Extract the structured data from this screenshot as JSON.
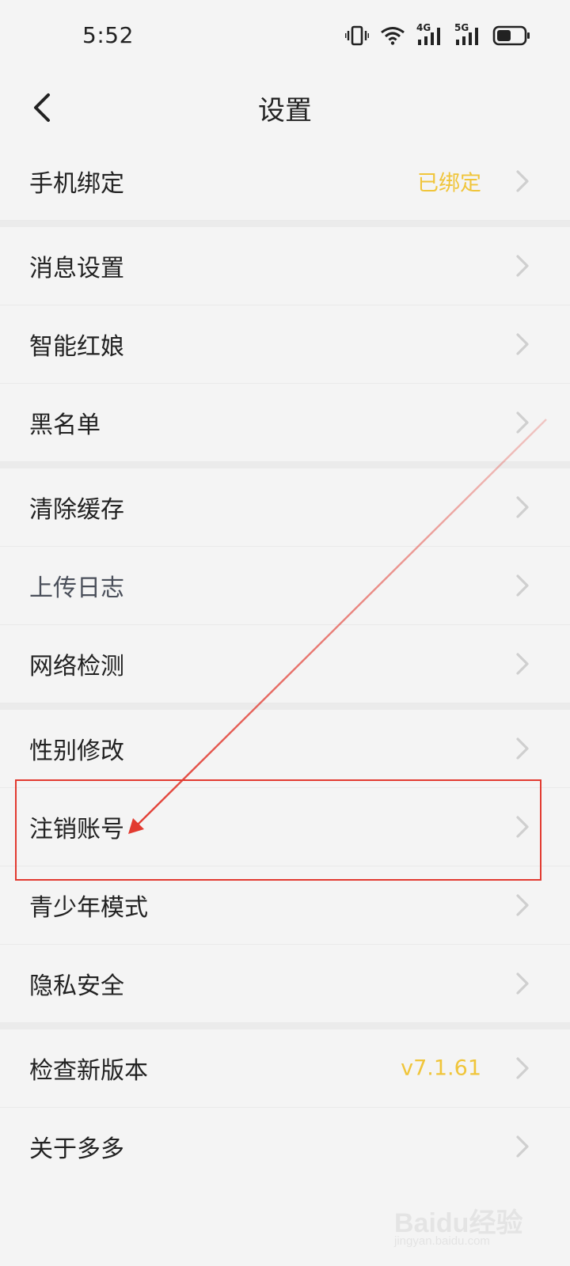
{
  "status_bar": {
    "time": "5:52",
    "icons": [
      "vibrate-icon",
      "wifi-icon",
      "signal-4g-icon",
      "signal-5g-icon",
      "battery-icon"
    ],
    "network_labels": [
      "4G",
      "5G"
    ]
  },
  "header": {
    "title": "设置",
    "back_icon": "back-arrow-icon"
  },
  "groups": [
    {
      "items": [
        {
          "label": "手机绑定",
          "value": "已绑定"
        }
      ]
    },
    {
      "items": [
        {
          "label": "消息设置"
        },
        {
          "label": "智能红娘"
        },
        {
          "label": "黑名单"
        }
      ]
    },
    {
      "items": [
        {
          "label": "清除缓存"
        },
        {
          "label": "上传日志"
        },
        {
          "label": "网络检测"
        }
      ]
    },
    {
      "items": [
        {
          "label": "性别修改"
        },
        {
          "label": "注销账号"
        },
        {
          "label": "青少年模式"
        },
        {
          "label": "隐私安全"
        }
      ]
    },
    {
      "items": [
        {
          "label": "检查新版本",
          "value": "v7.1.61"
        },
        {
          "label": "关于多多"
        }
      ]
    }
  ],
  "colors": {
    "accent_value": "#f0c53a",
    "annotation": "#e23a30",
    "background": "#f4f4f4"
  },
  "watermark": {
    "brand": "Baidu经验",
    "url": "jingyan.baidu.com"
  }
}
